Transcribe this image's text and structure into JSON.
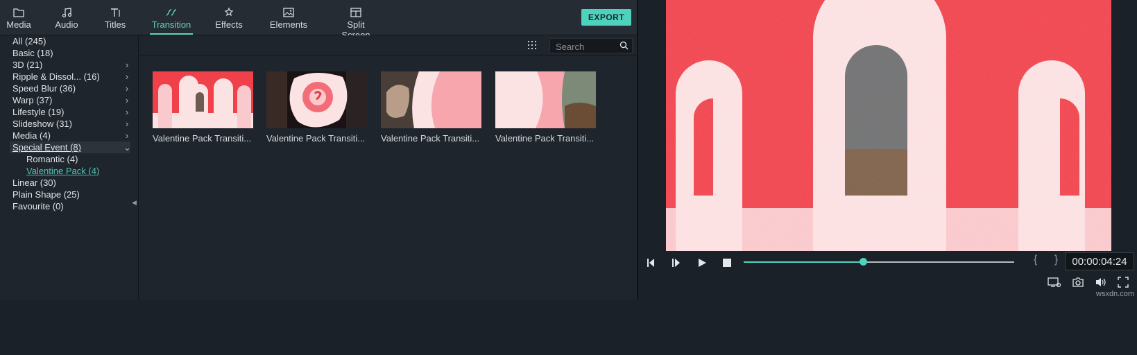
{
  "toolbar": {
    "tabs": [
      {
        "label": "Media",
        "icon": "folder-icon"
      },
      {
        "label": "Audio",
        "icon": "music-note-icon"
      },
      {
        "label": "Titles",
        "icon": "text-icon"
      },
      {
        "label": "Transition",
        "icon": "transition-icon",
        "active": true
      },
      {
        "label": "Effects",
        "icon": "effects-icon"
      },
      {
        "label": "Elements",
        "icon": "image-icon"
      },
      {
        "label": "Split Screen",
        "icon": "split-screen-icon"
      }
    ],
    "export_label": "EXPORT"
  },
  "categories": [
    {
      "label": "All (245)"
    },
    {
      "label": "Basic (18)"
    },
    {
      "label": "3D (21)",
      "chevron": ">"
    },
    {
      "label": "Ripple & Dissol... (16)",
      "chevron": ">"
    },
    {
      "label": "Speed Blur (36)",
      "chevron": ">"
    },
    {
      "label": "Warp (37)",
      "chevron": ">"
    },
    {
      "label": "Lifestyle (19)",
      "chevron": ">"
    },
    {
      "label": "Slideshow (31)",
      "chevron": ">"
    },
    {
      "label": "Media (4)",
      "chevron": ">"
    },
    {
      "label": "Special Event (8)",
      "chevron": "v",
      "expanded": true
    },
    {
      "label": "Romantic (4)",
      "sub": true
    },
    {
      "label": "Valentine Pack (4)",
      "sub": true,
      "active": true
    },
    {
      "label": "Linear (30)"
    },
    {
      "label": "Plain Shape (25)"
    },
    {
      "label": "Favourite (0)"
    }
  ],
  "search": {
    "placeholder": "Search"
  },
  "thumbnails": [
    {
      "caption": "Valentine Pack Transiti..."
    },
    {
      "caption": "Valentine Pack Transiti..."
    },
    {
      "caption": "Valentine Pack Transiti..."
    },
    {
      "caption": "Valentine Pack Transiti..."
    }
  ],
  "player": {
    "timecode": "00:00:04:24",
    "progress": 0.44,
    "braces": "{ }"
  },
  "watermark": "wsxdn.com",
  "colors": {
    "accent": "#4fd2bd",
    "preview_red": "#f0404a",
    "preview_pink": "#fbe3e4"
  }
}
